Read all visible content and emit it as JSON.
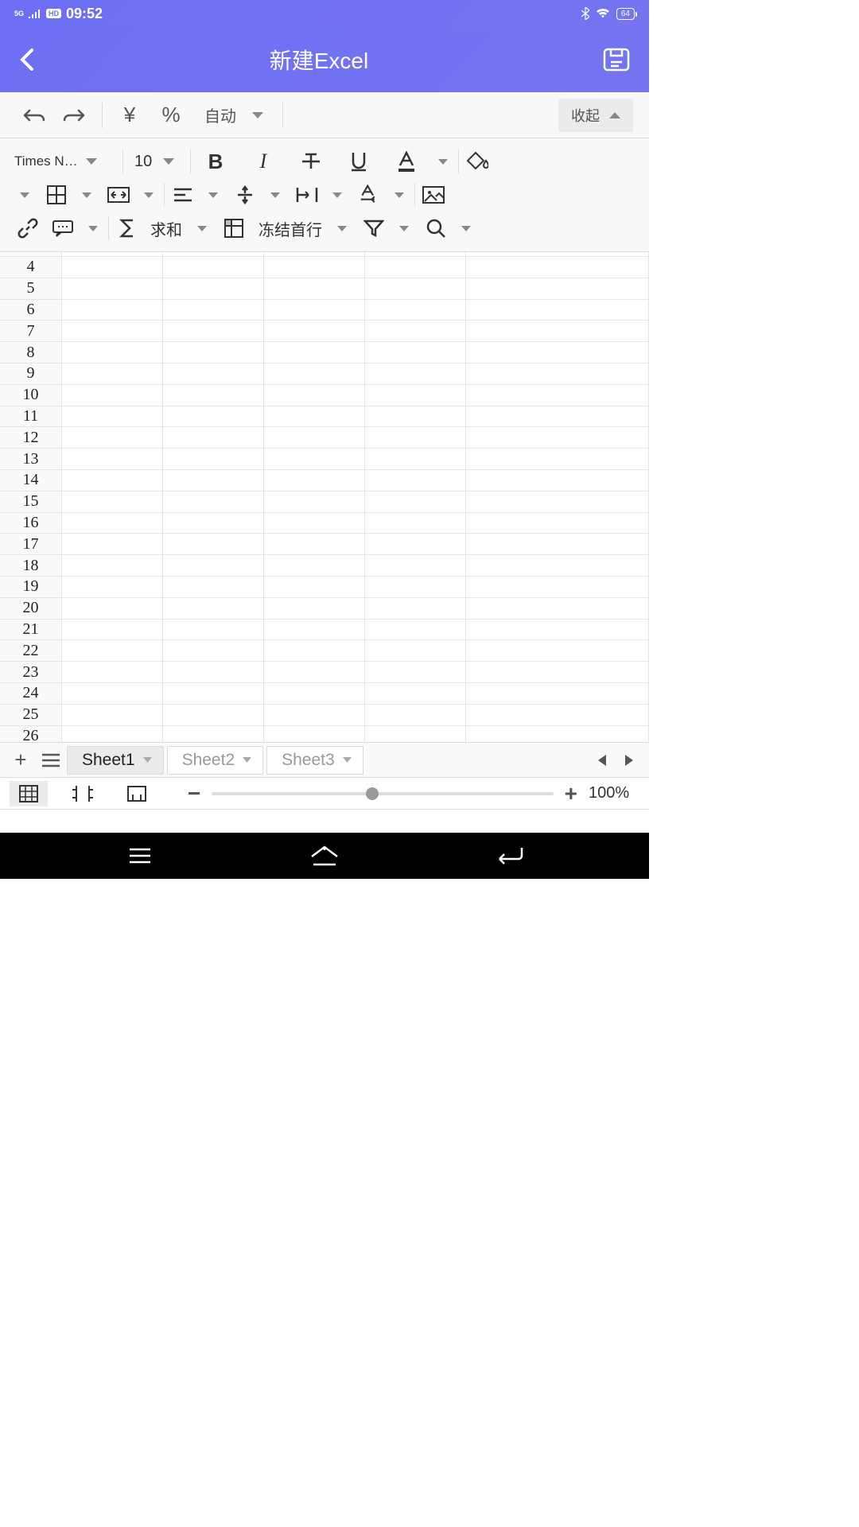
{
  "status": {
    "network": "5G",
    "hd": "HD",
    "time": "09:52",
    "battery": "64"
  },
  "header": {
    "title": "新建Excel"
  },
  "toolbar1": {
    "auto_label": "自动",
    "collapse_label": "收起"
  },
  "toolbar2": {
    "font_name": "Times N…",
    "font_size": "10",
    "sum_label": "求和",
    "freeze_label": "冻结首行"
  },
  "rows": [
    4,
    5,
    6,
    7,
    8,
    9,
    10,
    11,
    12,
    13,
    14,
    15,
    16,
    17,
    18,
    19,
    20,
    21,
    22,
    23,
    24,
    25,
    26
  ],
  "sheets": {
    "tabs": [
      "Sheet1",
      "Sheet2",
      "Sheet3"
    ],
    "active": 0
  },
  "zoom": {
    "value": "100%"
  }
}
